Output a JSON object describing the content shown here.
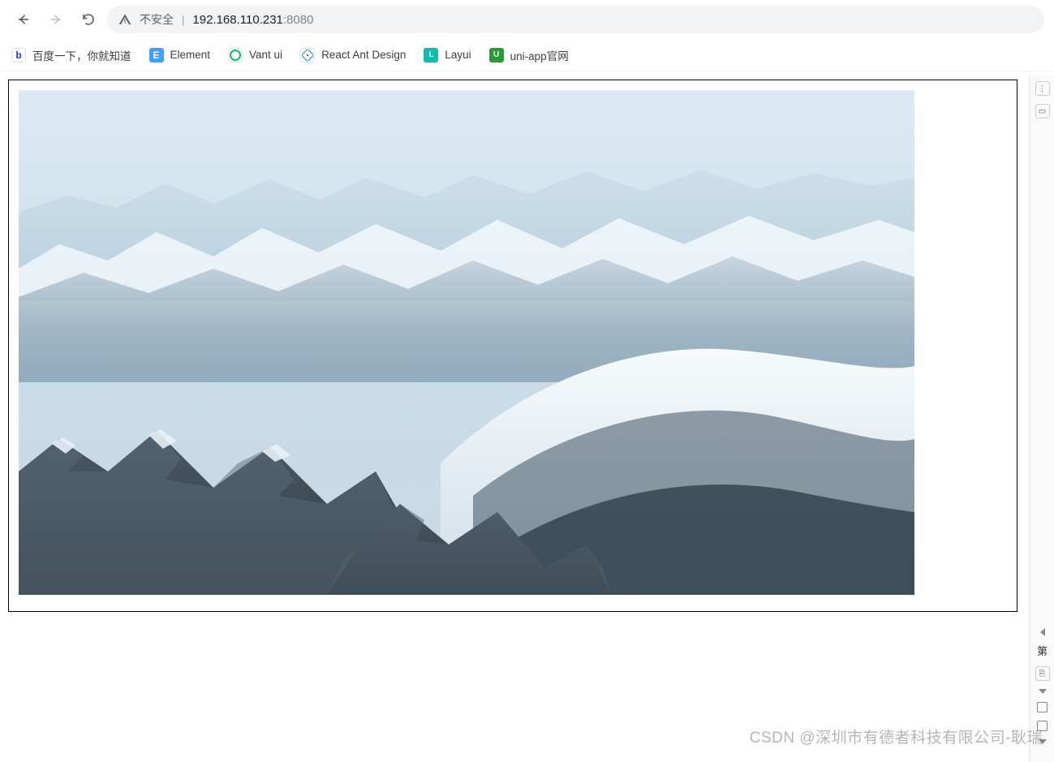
{
  "toolbar": {
    "insecure_label": "不安全",
    "address_host": "192.168.110.231",
    "address_port": ":8080"
  },
  "bookmarks": [
    {
      "label": "百度一下，你就知道",
      "icon": "baidu",
      "bg": "#ffffff",
      "fg": "#2932e1"
    },
    {
      "label": "Element",
      "icon": "element",
      "bg": "#409eff",
      "fg": "#ffffff"
    },
    {
      "label": "Vant ui",
      "icon": "vant",
      "bg": "#07c160",
      "fg": "#ffffff"
    },
    {
      "label": "React Ant Design",
      "icon": "antd",
      "bg": "#ffffff",
      "fg": "#f5222d"
    },
    {
      "label": "Layui",
      "icon": "layui",
      "bg": "#16baaa",
      "fg": "#ffffff"
    },
    {
      "label": "uni-app官网",
      "icon": "uniapp",
      "bg": "#2b9939",
      "fg": "#ffffff"
    }
  ],
  "sidebar": {
    "label_char": "第"
  },
  "content": {
    "image_alt": "Snow-covered mountain range landscape photograph"
  },
  "watermark": "CSDN @深圳市有德者科技有限公司-耿瑞"
}
